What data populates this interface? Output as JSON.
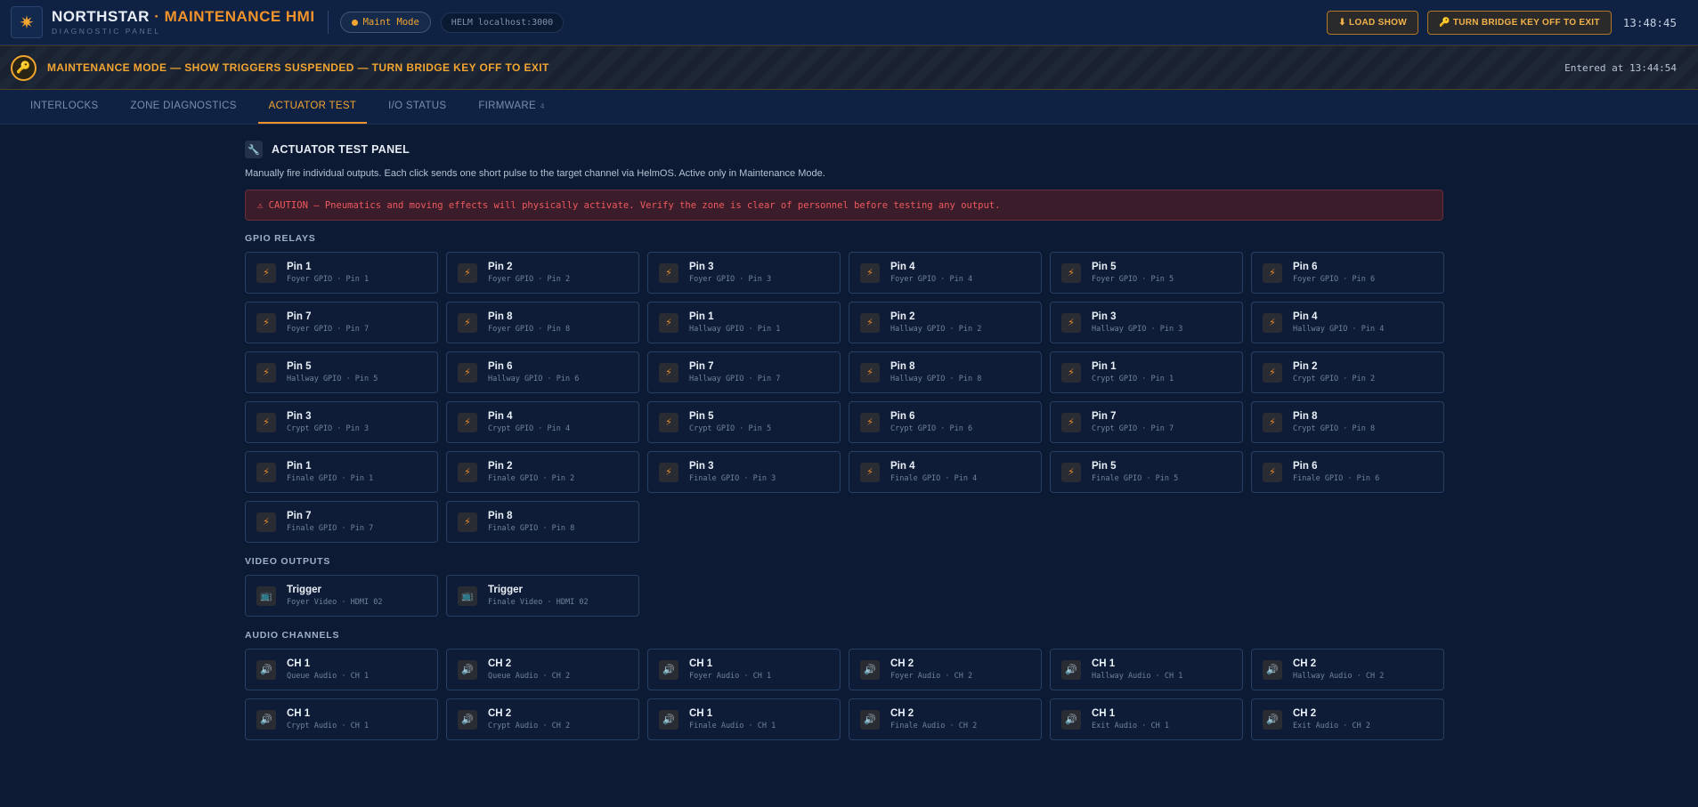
{
  "header": {
    "logo_icon": "compass-star-icon",
    "title_main": "NORTHSTAR",
    "title_accent": "· MAINTENANCE HMI",
    "subtitle": "DIAGNOSTIC PANEL",
    "mode_pill": "Maint Mode",
    "helm_pill": "HELM localhost:3000",
    "load_show_label": "⬇ LOAD SHOW",
    "key_off_label": "🔑 TURN BRIDGE KEY OFF TO EXIT",
    "clock": "13:48:45"
  },
  "banner": {
    "icon": "key-icon",
    "text": "MAINTENANCE MODE — SHOW TRIGGERS SUSPENDED — TURN BRIDGE KEY OFF TO EXIT",
    "entered": "Entered at 13:44:54"
  },
  "tabs": [
    {
      "label": "INTERLOCKS",
      "count": ""
    },
    {
      "label": "ZONE DIAGNOSTICS",
      "count": ""
    },
    {
      "label": "ACTUATOR TEST",
      "count": ""
    },
    {
      "label": "I/O STATUS",
      "count": ""
    },
    {
      "label": "FIRMWARE",
      "count": "4"
    }
  ],
  "active_tab": "ACTUATOR TEST",
  "panel": {
    "icon": "wrench-icon",
    "title": "ACTUATOR TEST PANEL",
    "description": "Manually fire individual outputs. Each click sends one short pulse to the target channel via HelmOS. Active only in Maintenance Mode.",
    "caution": "⚠ CAUTION — Pneumatics and moving effects will physically activate. Verify the zone is clear of personnel before testing any output."
  },
  "sections": {
    "gpio_label": "GPIO RELAYS",
    "video_label": "VIDEO OUTPUTS",
    "audio_label": "AUDIO CHANNELS"
  },
  "icons": {
    "relay": "⚡",
    "video": "📺",
    "audio": "🔊"
  },
  "gpio": [
    {
      "label": "Pin 1",
      "sub": "Foyer GPIO · Pin 1"
    },
    {
      "label": "Pin 2",
      "sub": "Foyer GPIO · Pin 2"
    },
    {
      "label": "Pin 3",
      "sub": "Foyer GPIO · Pin 3"
    },
    {
      "label": "Pin 4",
      "sub": "Foyer GPIO · Pin 4"
    },
    {
      "label": "Pin 5",
      "sub": "Foyer GPIO · Pin 5"
    },
    {
      "label": "Pin 6",
      "sub": "Foyer GPIO · Pin 6"
    },
    {
      "label": "Pin 7",
      "sub": "Foyer GPIO · Pin 7"
    },
    {
      "label": "Pin 8",
      "sub": "Foyer GPIO · Pin 8"
    },
    {
      "label": "Pin 1",
      "sub": "Hallway GPIO · Pin 1"
    },
    {
      "label": "Pin 2",
      "sub": "Hallway GPIO · Pin 2"
    },
    {
      "label": "Pin 3",
      "sub": "Hallway GPIO · Pin 3"
    },
    {
      "label": "Pin 4",
      "sub": "Hallway GPIO · Pin 4"
    },
    {
      "label": "Pin 5",
      "sub": "Hallway GPIO · Pin 5"
    },
    {
      "label": "Pin 6",
      "sub": "Hallway GPIO · Pin 6"
    },
    {
      "label": "Pin 7",
      "sub": "Hallway GPIO · Pin 7"
    },
    {
      "label": "Pin 8",
      "sub": "Hallway GPIO · Pin 8"
    },
    {
      "label": "Pin 1",
      "sub": "Crypt GPIO · Pin 1"
    },
    {
      "label": "Pin 2",
      "sub": "Crypt GPIO · Pin 2"
    },
    {
      "label": "Pin 3",
      "sub": "Crypt GPIO · Pin 3"
    },
    {
      "label": "Pin 4",
      "sub": "Crypt GPIO · Pin 4"
    },
    {
      "label": "Pin 5",
      "sub": "Crypt GPIO · Pin 5"
    },
    {
      "label": "Pin 6",
      "sub": "Crypt GPIO · Pin 6"
    },
    {
      "label": "Pin 7",
      "sub": "Crypt GPIO · Pin 7"
    },
    {
      "label": "Pin 8",
      "sub": "Crypt GPIO · Pin 8"
    },
    {
      "label": "Pin 1",
      "sub": "Finale GPIO · Pin 1"
    },
    {
      "label": "Pin 2",
      "sub": "Finale GPIO · Pin 2"
    },
    {
      "label": "Pin 3",
      "sub": "Finale GPIO · Pin 3"
    },
    {
      "label": "Pin 4",
      "sub": "Finale GPIO · Pin 4"
    },
    {
      "label": "Pin 5",
      "sub": "Finale GPIO · Pin 5"
    },
    {
      "label": "Pin 6",
      "sub": "Finale GPIO · Pin 6"
    },
    {
      "label": "Pin 7",
      "sub": "Finale GPIO · Pin 7"
    },
    {
      "label": "Pin 8",
      "sub": "Finale GPIO · Pin 8"
    }
  ],
  "video": [
    {
      "label": "Trigger",
      "sub": "Foyer Video · HDMI 02"
    },
    {
      "label": "Trigger",
      "sub": "Finale Video · HDMI 02"
    }
  ],
  "audio": [
    {
      "label": "CH 1",
      "sub": "Queue Audio · CH 1"
    },
    {
      "label": "CH 2",
      "sub": "Queue Audio · CH 2"
    },
    {
      "label": "CH 1",
      "sub": "Foyer Audio · CH 1"
    },
    {
      "label": "CH 2",
      "sub": "Foyer Audio · CH 2"
    },
    {
      "label": "CH 1",
      "sub": "Hallway Audio · CH 1"
    },
    {
      "label": "CH 2",
      "sub": "Hallway Audio · CH 2"
    },
    {
      "label": "CH 1",
      "sub": "Crypt Audio · CH 1"
    },
    {
      "label": "CH 2",
      "sub": "Crypt Audio · CH 2"
    },
    {
      "label": "CH 1",
      "sub": "Finale Audio · CH 1"
    },
    {
      "label": "CH 2",
      "sub": "Finale Audio · CH 2"
    },
    {
      "label": "CH 1",
      "sub": "Exit Audio · CH 1"
    },
    {
      "label": "CH 2",
      "sub": "Exit Audio · CH 2"
    }
  ]
}
